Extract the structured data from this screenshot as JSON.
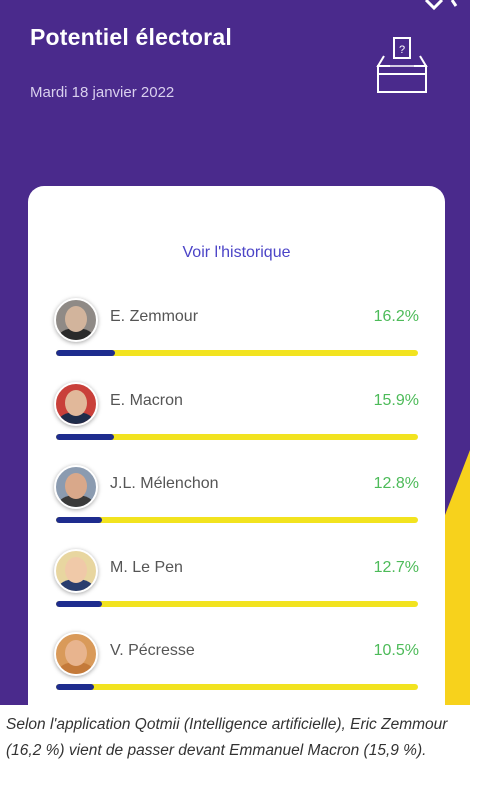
{
  "header": {
    "title": "Potentiel électoral",
    "date": "Mardi 18 janvier 2022",
    "ballot_icon": "ballot-box-icon"
  },
  "card": {
    "history_link": "Voir l'historique"
  },
  "candidates": [
    {
      "name": "E. Zemmour",
      "percent_text": "16.2%",
      "percent": 16.2,
      "avatar_colors": {
        "skin": "#d2b49c",
        "clothes": "#2b2b2b",
        "bg": "#8f8a86"
      }
    },
    {
      "name": "E. Macron",
      "percent_text": "15.9%",
      "percent": 15.9,
      "avatar_colors": {
        "skin": "#e1b89a",
        "clothes": "#1f2c4a",
        "bg": "#c9403a"
      }
    },
    {
      "name": "J.L. Mélenchon",
      "percent_text": "12.8%",
      "percent": 12.8,
      "avatar_colors": {
        "skin": "#d9a88a",
        "clothes": "#3a3a3a",
        "bg": "#8b9bb0"
      }
    },
    {
      "name": "M. Le Pen",
      "percent_text": "12.7%",
      "percent": 12.7,
      "avatar_colors": {
        "skin": "#f0c9a8",
        "clothes": "#2a3d6e",
        "bg": "#e8d6a0"
      }
    },
    {
      "name": "V. Pécresse",
      "percent_text": "10.5%",
      "percent": 10.5,
      "avatar_colors": {
        "skin": "#e8b48e",
        "clothes": "#c47a3a",
        "bg": "#d99a5a"
      }
    }
  ],
  "bar_scale_max": 100,
  "colors": {
    "background": "#4a2a8c",
    "accent_yellow": "#f7d21c",
    "bar_fill": "#1e2c8e",
    "bar_track": "#f2e31f",
    "percent_green": "#4dbb59",
    "link_blue": "#4b44c7"
  },
  "caption": "Selon l'application Qotmii (Intelligence artificielle), Eric Zemmour (16,2 %) vient de passer devant Emmanuel Macron (15,9 %)."
}
